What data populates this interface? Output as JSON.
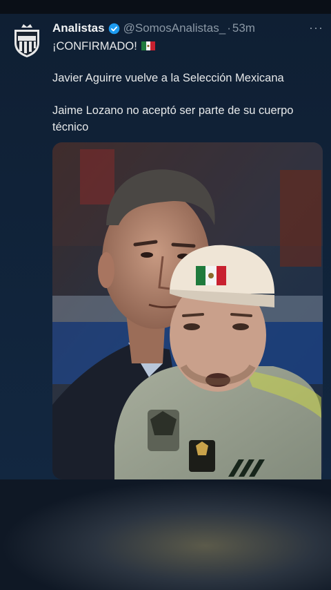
{
  "tweet": {
    "account_name": "Analistas",
    "handle": "@SomosAnalistas_",
    "separator": "·",
    "time": "53m",
    "more_label": "···",
    "lines": [
      "¡CONFIRMADO!",
      "Javier Aguirre vuelve a la Selección Mexicana",
      "Jaime Lozano no aceptó ser parte de su cuerpo",
      "técnico"
    ]
  },
  "colors": {
    "background": "#0e1a2b",
    "verified_badge": "#1d9bf0",
    "secondary_text": "#8b98a5",
    "primary_text": "#e7e9ea"
  },
  "icons": {
    "avatar": "club-crest-icon",
    "verified": "verified-badge-icon",
    "flag": "mexico-flag-icon",
    "more": "more-options-icon"
  }
}
